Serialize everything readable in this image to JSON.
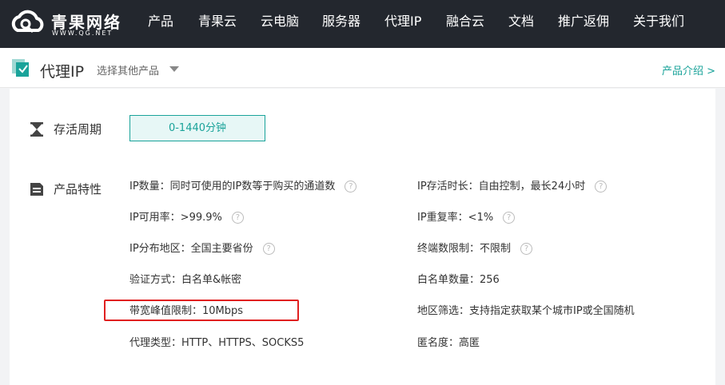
{
  "nav": {
    "brand": "青果网络",
    "domain": "WWW.QG.NET",
    "items": [
      {
        "label": "产品"
      },
      {
        "label": "青果云"
      },
      {
        "label": "云电脑"
      },
      {
        "label": "服务器"
      },
      {
        "label": "代理IP"
      },
      {
        "label": "融合云"
      },
      {
        "label": "文档"
      },
      {
        "label": "推广返佣"
      },
      {
        "label": "关于我们"
      }
    ]
  },
  "subheader": {
    "title": "代理IP",
    "select_label": "选择其他产品",
    "intro_link": "产品介绍 >"
  },
  "survival": {
    "label": "存活周期",
    "value": "0-1440分钟"
  },
  "features": {
    "label": "产品特性",
    "left": [
      {
        "text": "IP数量：同时可使用的IP数等于购买的通道数",
        "help": true
      },
      {
        "text": "IP可用率：>99.9%",
        "help": true
      },
      {
        "text": "IP分布地区：全国主要省份",
        "help": true
      },
      {
        "text": "验证方式：白名单&帐密",
        "help": false
      },
      {
        "text": "带宽峰值限制：10Mbps",
        "help": false
      },
      {
        "text": "代理类型：HTTP、HTTPS、SOCKS5",
        "help": false
      }
    ],
    "right": [
      {
        "text": "IP存活时长：自由控制，最长24小时",
        "help": true
      },
      {
        "text": "IP重复率：<1%",
        "help": true
      },
      {
        "text": "终端数限制：不限制",
        "help": true
      },
      {
        "text": "白名单数量：256",
        "help": false
      },
      {
        "text": "地区筛选：支持指定获取某个城市IP或全国随机",
        "help": false
      },
      {
        "text": "匿名度：高匿",
        "help": false
      }
    ]
  },
  "help_glyph": "?",
  "colors": {
    "nav_bg": "#23272e",
    "accent": "#1aa39a",
    "highlight": "#e02020"
  }
}
